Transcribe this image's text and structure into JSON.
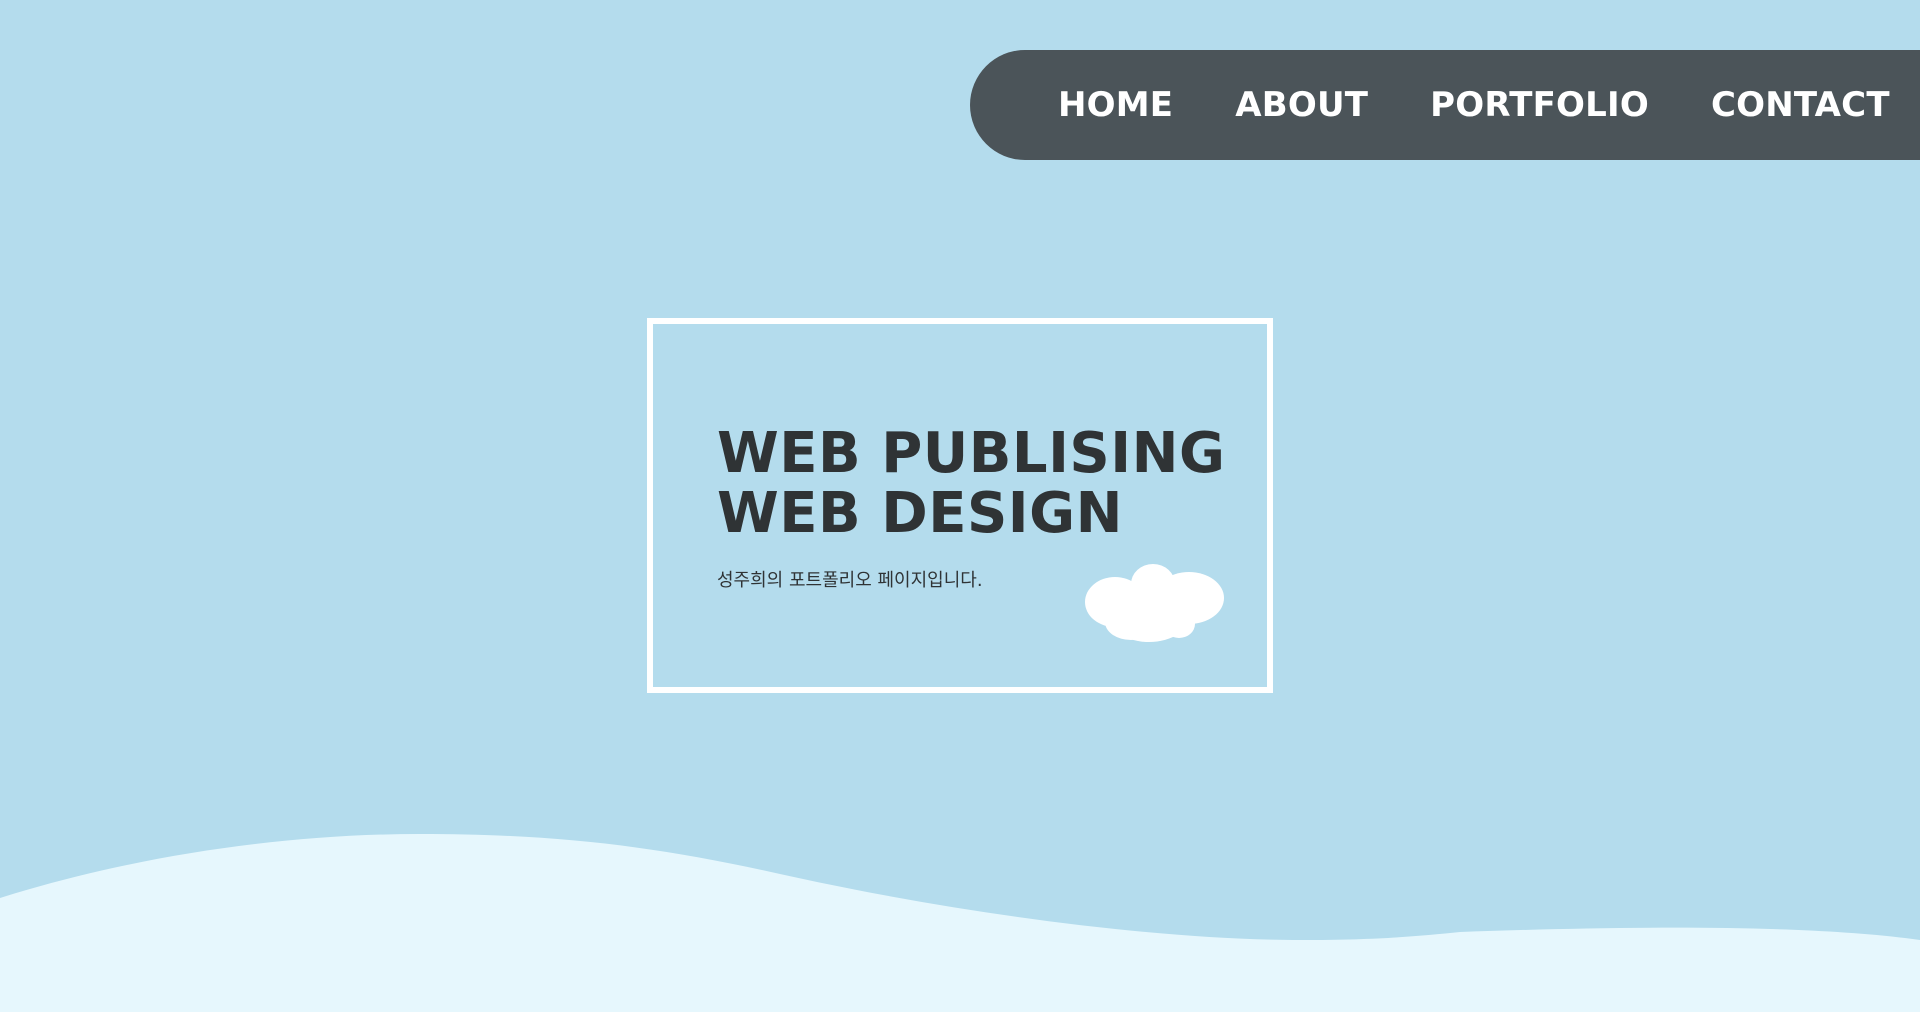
{
  "nav": {
    "items": [
      {
        "label": "HOME"
      },
      {
        "label": "ABOUT"
      },
      {
        "label": "PORTFOLIO"
      },
      {
        "label": "CONTACT"
      }
    ]
  },
  "hero": {
    "title_line1": "WEB PUBLISING",
    "title_line2": "WEB DESIGN",
    "subtitle": "성주희의 포트폴리오 페이지입니다."
  },
  "icons": {
    "cloud": "cloud-icon"
  },
  "colors": {
    "background": "#b4dced",
    "nav_background": "#4b5459",
    "nav_text": "#ffffff",
    "heading_text": "#2f3335",
    "box_border": "#ffffff",
    "wave": "#e6f7fd"
  }
}
